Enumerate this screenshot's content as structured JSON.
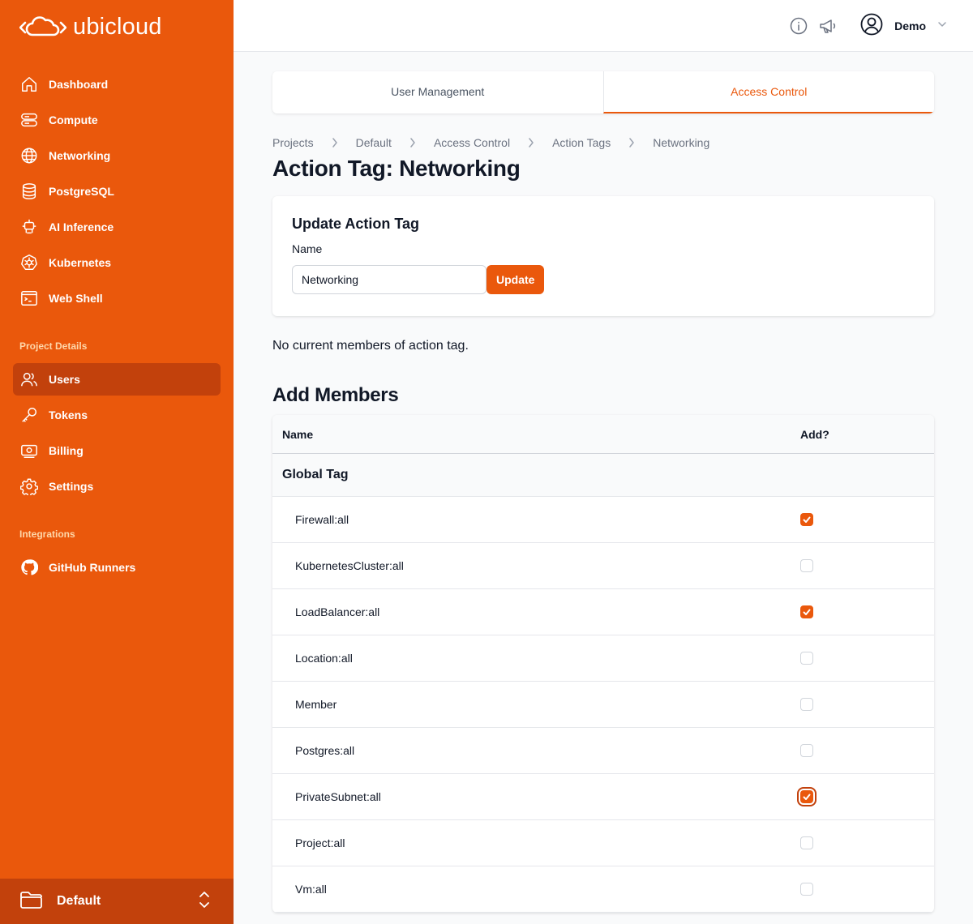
{
  "brand": {
    "name": "ubicloud"
  },
  "sidebar": {
    "items": [
      {
        "label": "Dashboard",
        "icon": "home-icon"
      },
      {
        "label": "Compute",
        "icon": "server-icon"
      },
      {
        "label": "Networking",
        "icon": "globe-icon"
      },
      {
        "label": "PostgreSQL",
        "icon": "database-icon"
      },
      {
        "label": "AI Inference",
        "icon": "robot-icon"
      },
      {
        "label": "Kubernetes",
        "icon": "kubernetes-icon"
      },
      {
        "label": "Web Shell",
        "icon": "terminal-icon"
      }
    ],
    "project_section": "Project Details",
    "project_items": [
      {
        "label": "Users",
        "icon": "users-icon",
        "active": true
      },
      {
        "label": "Tokens",
        "icon": "key-icon"
      },
      {
        "label": "Billing",
        "icon": "banknote-icon"
      },
      {
        "label": "Settings",
        "icon": "gear-icon"
      }
    ],
    "integrations_section": "Integrations",
    "integration_items": [
      {
        "label": "GitHub Runners",
        "icon": "github-icon"
      }
    ],
    "project_switcher": {
      "label": "Default"
    }
  },
  "topbar": {
    "user_name": "Demo"
  },
  "tabs": [
    {
      "label": "User Management",
      "active": false
    },
    {
      "label": "Access Control",
      "active": true
    }
  ],
  "breadcrumb": [
    "Projects",
    "Default",
    "Access Control",
    "Action Tags",
    "Networking"
  ],
  "page_title": "Action Tag: Networking",
  "update_card": {
    "title": "Update Action Tag",
    "name_label": "Name",
    "name_value": "Networking",
    "button": "Update"
  },
  "members_note": "No current members of action tag.",
  "add_members": {
    "title": "Add Members",
    "columns": {
      "name": "Name",
      "add": "Add?"
    },
    "group": "Global Tag",
    "rows": [
      {
        "name": "Firewall:all",
        "checked": true
      },
      {
        "name": "KubernetesCluster:all",
        "checked": false
      },
      {
        "name": "LoadBalancer:all",
        "checked": true
      },
      {
        "name": "Location:all",
        "checked": false
      },
      {
        "name": "Member",
        "checked": false
      },
      {
        "name": "Postgres:all",
        "checked": false
      },
      {
        "name": "PrivateSubnet:all",
        "checked": true,
        "focused": true
      },
      {
        "name": "Project:all",
        "checked": false
      },
      {
        "name": "Vm:all",
        "checked": false
      }
    ]
  },
  "colors": {
    "brand": "#ea580c",
    "brand_dark": "#c2410c",
    "section_label": "#fed7aa"
  }
}
